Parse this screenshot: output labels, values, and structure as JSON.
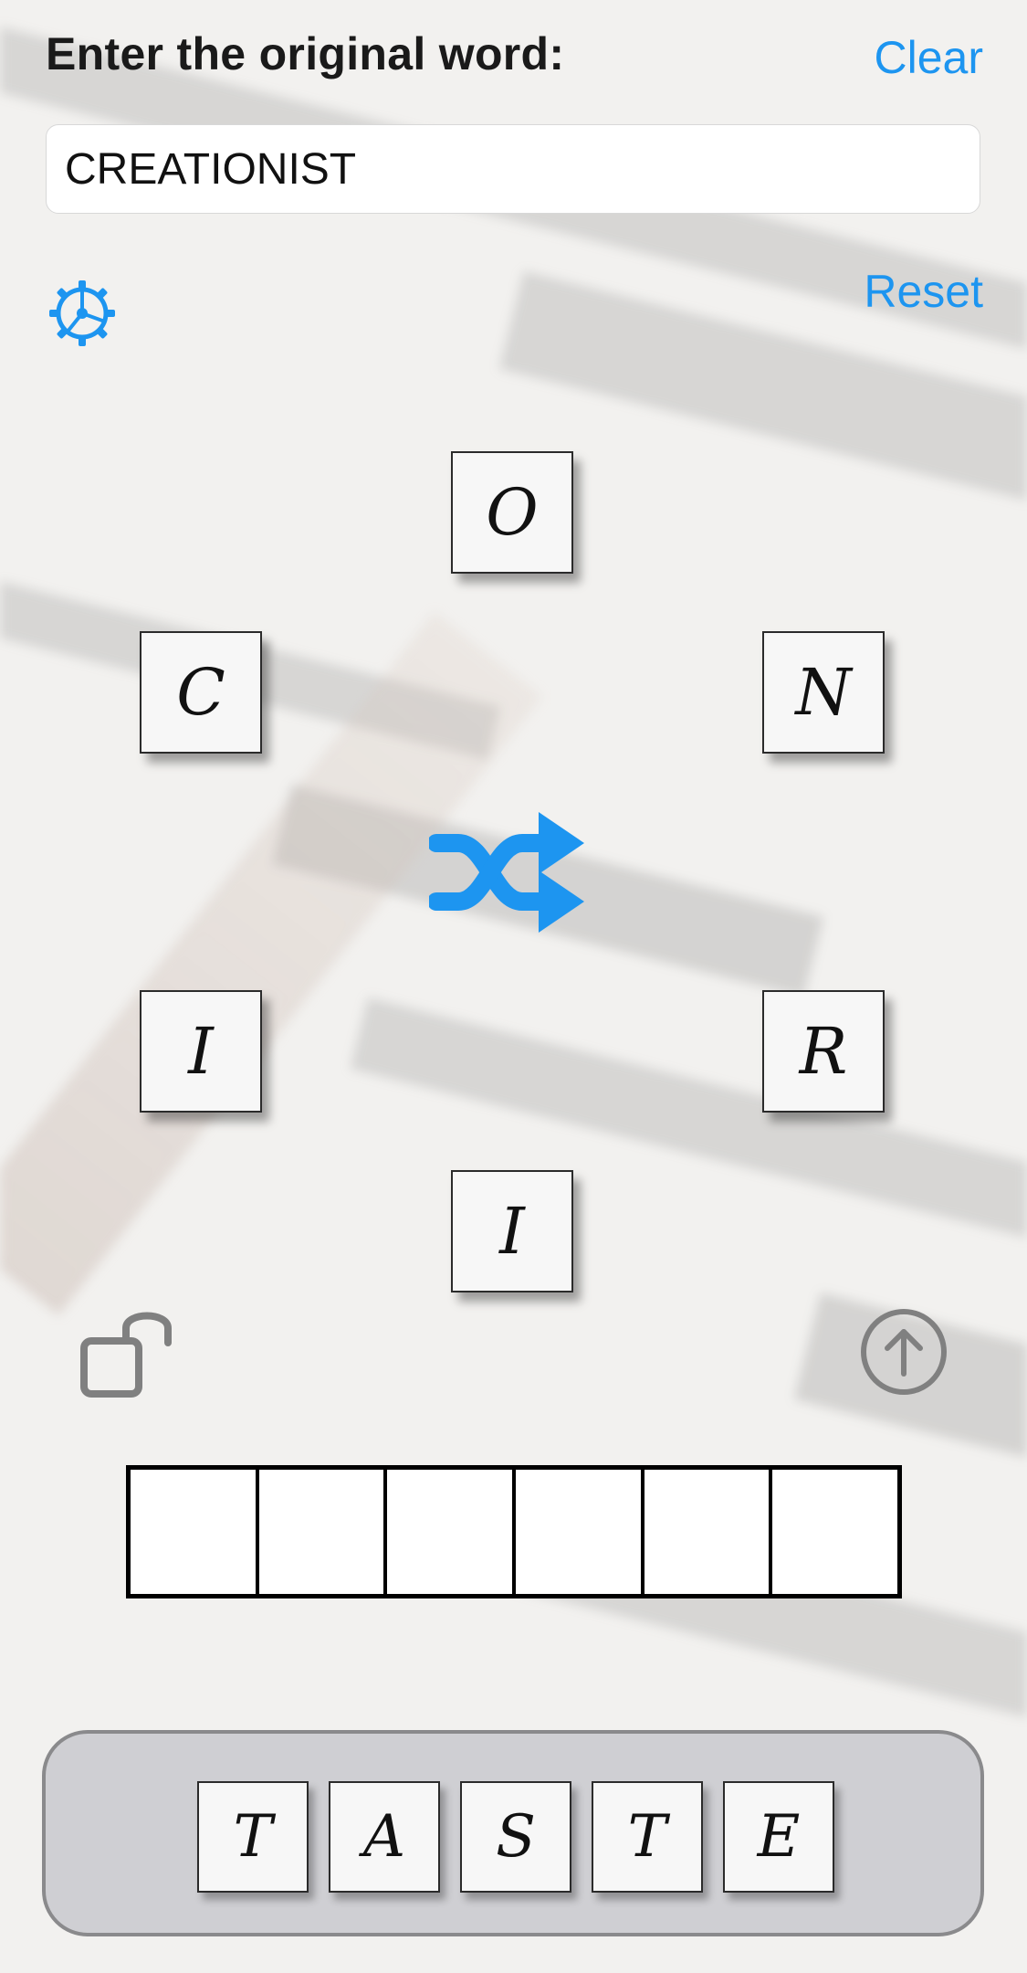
{
  "header": {
    "title": "Enter the original word:",
    "clear_label": "Clear"
  },
  "word_input": {
    "value": "CREATIONIST"
  },
  "controls": {
    "reset_label": "Reset",
    "settings_icon": "gear-icon",
    "shuffle_icon": "shuffle-icon",
    "lock_icon": "unlocked-padlock-icon",
    "submit_icon": "arrow-up-circle-icon",
    "accent_color": "#1d95f0"
  },
  "wheel": {
    "letters": [
      "O",
      "C",
      "N",
      "I",
      "R",
      "I"
    ]
  },
  "answer": {
    "slot_count": 6
  },
  "tray": {
    "letters": [
      "T",
      "A",
      "S",
      "T",
      "E"
    ]
  }
}
